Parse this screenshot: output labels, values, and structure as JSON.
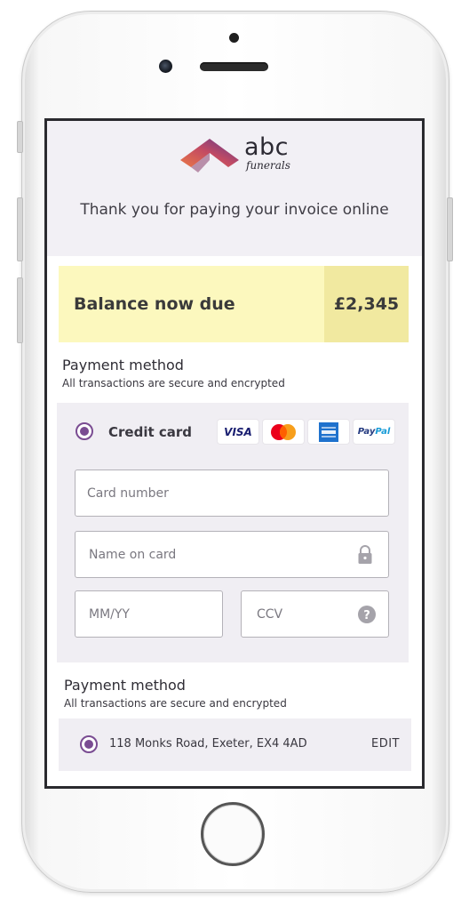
{
  "brand": {
    "name": "abc",
    "sub": "funerals",
    "colors": {
      "accent": "#7a4c92",
      "logo_gradient_start": "#e8744a",
      "logo_gradient_end": "#5a3a8c"
    }
  },
  "header": {
    "thank_you": "Thank you for paying your invoice online"
  },
  "balance": {
    "label": "Balance now due",
    "amount": "£2,345",
    "colors": {
      "label_bg": "#fcf8be",
      "amount_bg": "#f1e9a0"
    }
  },
  "payment_section_1": {
    "title": "Payment method",
    "subtitle": "All transactions are secure and encrypted"
  },
  "credit_card": {
    "label": "Credit card",
    "selected": true,
    "card_logos": [
      {
        "name": "visa-logo",
        "text": "VISA"
      },
      {
        "name": "mastercard-logo",
        "text": "MasterCard"
      },
      {
        "name": "amex-logo"
      },
      {
        "name": "paypal-logo",
        "text": "PayPal"
      }
    ],
    "fields": {
      "card_number": {
        "placeholder": "Card number",
        "value": ""
      },
      "name_on_card": {
        "placeholder": "Name on card",
        "value": "",
        "icon": "lock-icon"
      },
      "expiry": {
        "placeholder": "MM/YY",
        "value": ""
      },
      "ccv": {
        "placeholder": "CCV",
        "value": "",
        "icon": "help-icon"
      }
    }
  },
  "payment_section_2": {
    "title": "Payment method",
    "subtitle": "All transactions are secure and encrypted"
  },
  "address": {
    "text": "118 Monks Road, Exeter, EX4 4AD",
    "edit_label": "EDIT",
    "selected": true
  }
}
